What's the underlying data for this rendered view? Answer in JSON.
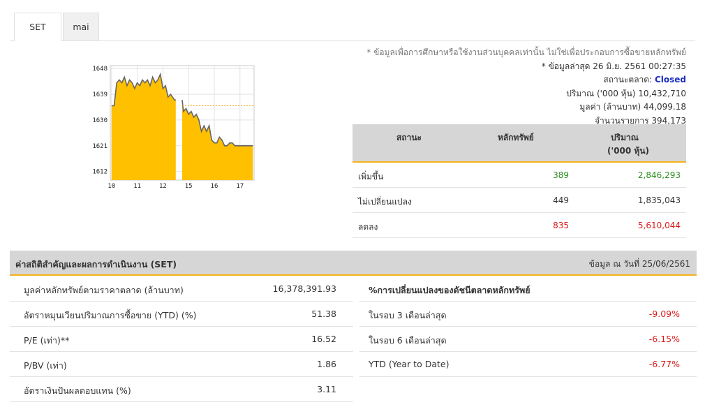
{
  "tabs": [
    {
      "label": "SET",
      "active": true
    },
    {
      "label": "mai",
      "active": false
    }
  ],
  "info": {
    "note": "* ข้อมูลเพื่อการศึกษาหรือใช้งานส่วนบุคคลเท่านั้น ไม่ใช่เพื่อประกอบการซื้อขายหลักทรัพย์",
    "updated": "* ข้อมูลล่าสุด 26 มิ.ย. 2561 00:27:35",
    "status_label": "สถานะตลาด:",
    "status_value": "Closed",
    "volume_label": "ปริมาณ ('000 หุ้น)",
    "volume_value": "10,432,710",
    "value_label": "มูลค่า (ล้านบาท)",
    "value_value": "44,099.18",
    "trades_label": "จำนวนรายการ",
    "trades_value": "394,173"
  },
  "market_table": {
    "headers": {
      "status": "สถานะ",
      "securities": "หลักทรัพย์",
      "volume": "ปริมาณ",
      "volume_unit": "('000 หุ้น)"
    },
    "rows": [
      {
        "label": "เพิ่มขึ้น",
        "count": "389",
        "volume": "2,846,293",
        "color": "#2a8c1c"
      },
      {
        "label": "ไม่เปลี่ยนแปลง",
        "count": "449",
        "volume": "1,835,043",
        "color": "#333333"
      },
      {
        "label": "ลดลง",
        "count": "835",
        "volume": "5,610,044",
        "color": "#d71c1c"
      }
    ]
  },
  "stats": {
    "title": "ค่าสถิติสำคัญและผลการดำเนินงาน (SET)",
    "date": "ข้อมูล ณ วันที่ 25/06/2561",
    "left_rows": [
      {
        "label": "มูลค่าหลักทรัพย์ตามราคาตลาด (ล้านบาท)",
        "value": "16,378,391.93"
      },
      {
        "label": "อัตราหมุนเวียนปริมาณการซื้อขาย (YTD) (%)",
        "value": "51.38"
      },
      {
        "label": "P/E (เท่า)**",
        "value": "16.52"
      },
      {
        "label": "P/BV (เท่า)",
        "value": "1.86"
      },
      {
        "label": "อัตราเงินปันผลตอบแทน (%)",
        "value": "3.11"
      }
    ],
    "right_title": "%การเปลี่ยนแปลงของดัชนีตลาดหลักทรัพย์",
    "right_rows": [
      {
        "label": "ในรอบ 3 เดือนล่าสุด",
        "value": "-9.09%"
      },
      {
        "label": "ในรอบ 6 เดือนล่าสุด",
        "value": "-6.15%"
      },
      {
        "label": "YTD (Year to Date)",
        "value": "-6.77%"
      }
    ]
  },
  "chart_data": {
    "type": "area",
    "x_ticks": [
      "10",
      "11",
      "12",
      "15",
      "16",
      "17"
    ],
    "y_ticks": [
      "1648",
      "1639",
      "1630",
      "1621",
      "1612"
    ],
    "ylim": [
      1609,
      1649
    ],
    "prev_close": 1635,
    "fill_color": "#ffc000",
    "line_color": "#666666",
    "ref_color": "#f6a21a",
    "series": [
      {
        "x": [
          10.0,
          10.1,
          10.2,
          10.3,
          10.4,
          10.5,
          10.6,
          10.7,
          10.8,
          10.9,
          11.0,
          11.1,
          11.2,
          11.3,
          11.4,
          11.5,
          11.6,
          11.7,
          11.8,
          11.9,
          12.0,
          12.1,
          12.2,
          12.3,
          12.45,
          12.5
        ],
        "y": [
          1635,
          1635,
          1643,
          1644,
          1643,
          1645,
          1642,
          1644,
          1643,
          1641,
          1643,
          1642,
          1644,
          1643,
          1644,
          1642,
          1645,
          1643,
          1644,
          1646,
          1641,
          1642,
          1638,
          1639,
          1637,
          1637
        ]
      },
      {
        "x": [
          12.75,
          12.8,
          12.9,
          13.0,
          13.1,
          13.2,
          13.3,
          13.4,
          13.5,
          13.6,
          13.7,
          13.8,
          13.9,
          14.0,
          14.1,
          14.2,
          14.3,
          14.4,
          14.5,
          14.6,
          14.7,
          14.8,
          14.9,
          15.0,
          15.1,
          15.2,
          15.3,
          15.4,
          15.5
        ],
        "y": [
          1637,
          1633,
          1634,
          1632,
          1633,
          1631,
          1632,
          1630,
          1626,
          1628,
          1626,
          1628,
          1623,
          1622,
          1622,
          1624,
          1623,
          1621,
          1621,
          1622,
          1622,
          1621,
          1621,
          1621,
          1621,
          1621,
          1621,
          1621,
          1621
        ]
      }
    ]
  }
}
